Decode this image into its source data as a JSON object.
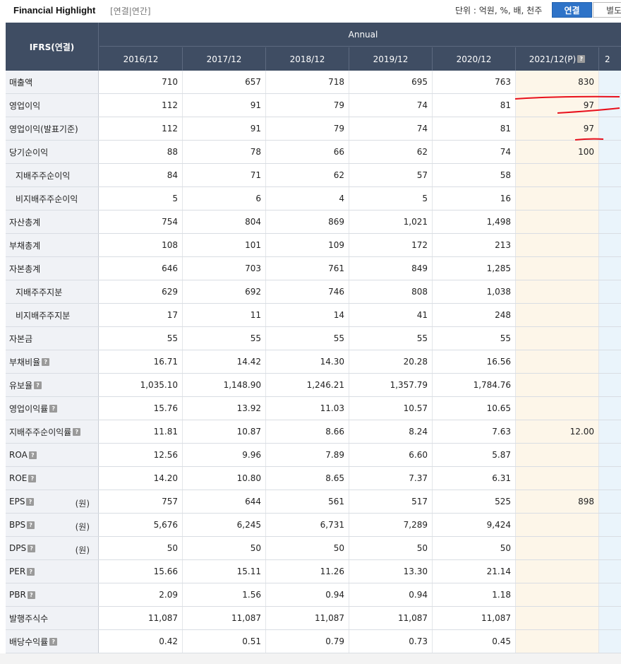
{
  "header": {
    "title": "Financial Highlight",
    "subtitle": "[연결|연간]",
    "unit": "단위 : 억원, %, 배, 천주",
    "tab_consolidated": "연결",
    "tab_separate": "별도"
  },
  "table": {
    "corner": "IFRS(연결)",
    "group": "Annual",
    "years": [
      "2016/12",
      "2017/12",
      "2018/12",
      "2019/12",
      "2020/12",
      "2021/12(P)",
      "2"
    ],
    "rows": [
      {
        "label": "매출액",
        "unit": "",
        "help": false,
        "sub": false,
        "values": [
          "710",
          "657",
          "718",
          "695",
          "763",
          "830",
          ""
        ]
      },
      {
        "label": "영업이익",
        "unit": "",
        "help": false,
        "sub": false,
        "values": [
          "112",
          "91",
          "79",
          "74",
          "81",
          "97",
          ""
        ]
      },
      {
        "label": "영업이익(발표기준)",
        "unit": "",
        "help": false,
        "sub": false,
        "values": [
          "112",
          "91",
          "79",
          "74",
          "81",
          "97",
          ""
        ]
      },
      {
        "label": "당기순이익",
        "unit": "",
        "help": false,
        "sub": false,
        "values": [
          "88",
          "78",
          "66",
          "62",
          "74",
          "100",
          ""
        ]
      },
      {
        "label": "지배주주순이익",
        "unit": "",
        "help": false,
        "sub": true,
        "values": [
          "84",
          "71",
          "62",
          "57",
          "58",
          "",
          ""
        ]
      },
      {
        "label": "비지배주주순이익",
        "unit": "",
        "help": false,
        "sub": true,
        "values": [
          "5",
          "6",
          "4",
          "5",
          "16",
          "",
          ""
        ]
      },
      {
        "label": "자산총계",
        "unit": "",
        "help": false,
        "sub": false,
        "values": [
          "754",
          "804",
          "869",
          "1,021",
          "1,498",
          "",
          ""
        ]
      },
      {
        "label": "부채총계",
        "unit": "",
        "help": false,
        "sub": false,
        "values": [
          "108",
          "101",
          "109",
          "172",
          "213",
          "",
          ""
        ]
      },
      {
        "label": "자본총계",
        "unit": "",
        "help": false,
        "sub": false,
        "values": [
          "646",
          "703",
          "761",
          "849",
          "1,285",
          "",
          ""
        ]
      },
      {
        "label": "지배주주지분",
        "unit": "",
        "help": false,
        "sub": true,
        "values": [
          "629",
          "692",
          "746",
          "808",
          "1,038",
          "",
          ""
        ]
      },
      {
        "label": "비지배주주지분",
        "unit": "",
        "help": false,
        "sub": true,
        "values": [
          "17",
          "11",
          "14",
          "41",
          "248",
          "",
          ""
        ]
      },
      {
        "label": "자본금",
        "unit": "",
        "help": false,
        "sub": false,
        "values": [
          "55",
          "55",
          "55",
          "55",
          "55",
          "",
          ""
        ]
      },
      {
        "label": "부채비율",
        "unit": "",
        "help": true,
        "sub": false,
        "values": [
          "16.71",
          "14.42",
          "14.30",
          "20.28",
          "16.56",
          "",
          ""
        ]
      },
      {
        "label": "유보율",
        "unit": "",
        "help": true,
        "sub": false,
        "values": [
          "1,035.10",
          "1,148.90",
          "1,246.21",
          "1,357.79",
          "1,784.76",
          "",
          ""
        ]
      },
      {
        "label": "영업이익률",
        "unit": "",
        "help": true,
        "sub": false,
        "values": [
          "15.76",
          "13.92",
          "11.03",
          "10.57",
          "10.65",
          "",
          ""
        ]
      },
      {
        "label": "지배주주순이익률",
        "unit": "",
        "help": true,
        "sub": false,
        "values": [
          "11.81",
          "10.87",
          "8.66",
          "8.24",
          "7.63",
          "12.00",
          ""
        ]
      },
      {
        "label": "ROA",
        "unit": "",
        "help": true,
        "sub": false,
        "values": [
          "12.56",
          "9.96",
          "7.89",
          "6.60",
          "5.87",
          "",
          ""
        ]
      },
      {
        "label": "ROE",
        "unit": "",
        "help": true,
        "sub": false,
        "values": [
          "14.20",
          "10.80",
          "8.65",
          "7.37",
          "6.31",
          "",
          ""
        ]
      },
      {
        "label": "EPS",
        "unit": "(원)",
        "help": true,
        "sub": false,
        "values": [
          "757",
          "644",
          "561",
          "517",
          "525",
          "898",
          ""
        ]
      },
      {
        "label": "BPS",
        "unit": "(원)",
        "help": true,
        "sub": false,
        "values": [
          "5,676",
          "6,245",
          "6,731",
          "7,289",
          "9,424",
          "",
          ""
        ]
      },
      {
        "label": "DPS",
        "unit": "(원)",
        "help": true,
        "sub": false,
        "values": [
          "50",
          "50",
          "50",
          "50",
          "50",
          "",
          ""
        ]
      },
      {
        "label": "PER",
        "unit": "",
        "help": true,
        "sub": false,
        "values": [
          "15.66",
          "15.11",
          "11.26",
          "13.30",
          "21.14",
          "",
          ""
        ]
      },
      {
        "label": "PBR",
        "unit": "",
        "help": true,
        "sub": false,
        "values": [
          "2.09",
          "1.56",
          "0.94",
          "0.94",
          "1.18",
          "",
          ""
        ]
      },
      {
        "label": "발행주식수",
        "unit": "",
        "help": false,
        "sub": false,
        "values": [
          "11,087",
          "11,087",
          "11,087",
          "11,087",
          "11,087",
          "",
          ""
        ]
      },
      {
        "label": "배당수익률",
        "unit": "",
        "help": true,
        "sub": false,
        "values": [
          "0.42",
          "0.51",
          "0.79",
          "0.73",
          "0.45",
          "",
          ""
        ]
      }
    ]
  },
  "colors": {
    "header_bg": "#3f4d63",
    "accent": "#2e73c8",
    "estimate_col": "#fdf6e9",
    "annotation": "#e8101c"
  }
}
